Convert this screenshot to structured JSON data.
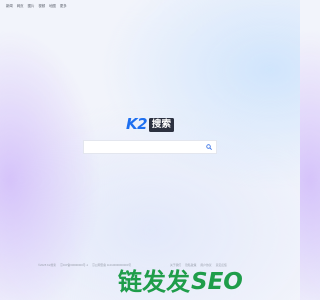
{
  "top_nav": {
    "items": [
      {
        "label": "新闻"
      },
      {
        "label": "网页"
      },
      {
        "label": "图片"
      },
      {
        "label": "视频"
      },
      {
        "label": "地图"
      },
      {
        "label": "更多"
      }
    ]
  },
  "logo": {
    "latin": "K2",
    "chinese": "搜索",
    "accent_color": "#1e6ff0",
    "box_color": "#2c3140"
  },
  "search": {
    "value": "",
    "placeholder": "",
    "button_icon": "search-icon"
  },
  "footer": {
    "left": [
      "©2025 K2搜索",
      "京ICP备00000000号-1",
      "京公网安备 11010000000000号"
    ],
    "right": [
      "关于我们",
      "隐私政策",
      "用户协议",
      "意见反馈"
    ]
  },
  "watermark": {
    "chinese": "链发发",
    "latin": "SEO",
    "color": "#1f9d4a"
  }
}
